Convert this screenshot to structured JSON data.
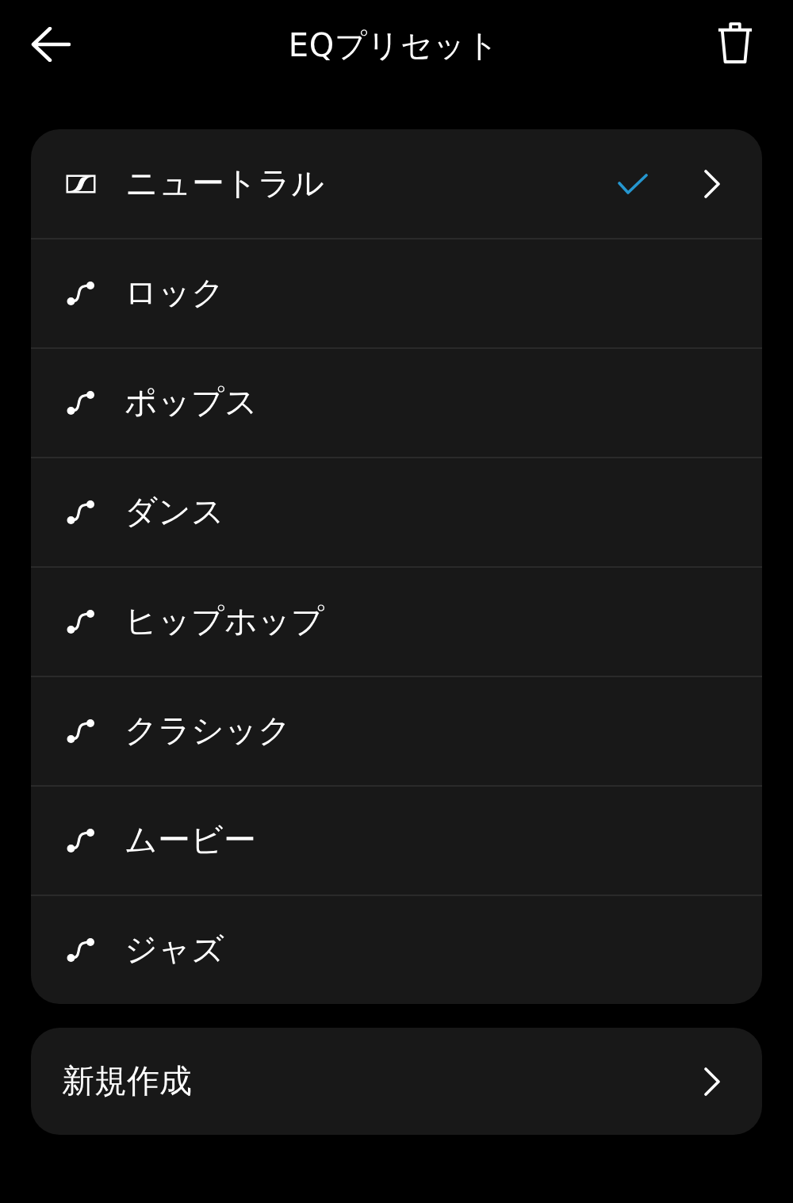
{
  "header": {
    "title": "EQプリセット"
  },
  "presets": [
    {
      "name": "ニュートラル",
      "kind": "logo",
      "selected": true
    },
    {
      "name": "ロック",
      "kind": "curve",
      "selected": false
    },
    {
      "name": "ポップス",
      "kind": "curve",
      "selected": false
    },
    {
      "name": "ダンス",
      "kind": "curve",
      "selected": false
    },
    {
      "name": "ヒップホップ",
      "kind": "curve",
      "selected": false
    },
    {
      "name": "クラシック",
      "kind": "curve",
      "selected": false
    },
    {
      "name": "ムービー",
      "kind": "curve",
      "selected": false
    },
    {
      "name": "ジャズ",
      "kind": "curve",
      "selected": false
    }
  ],
  "new_preset": {
    "label": "新規作成"
  }
}
